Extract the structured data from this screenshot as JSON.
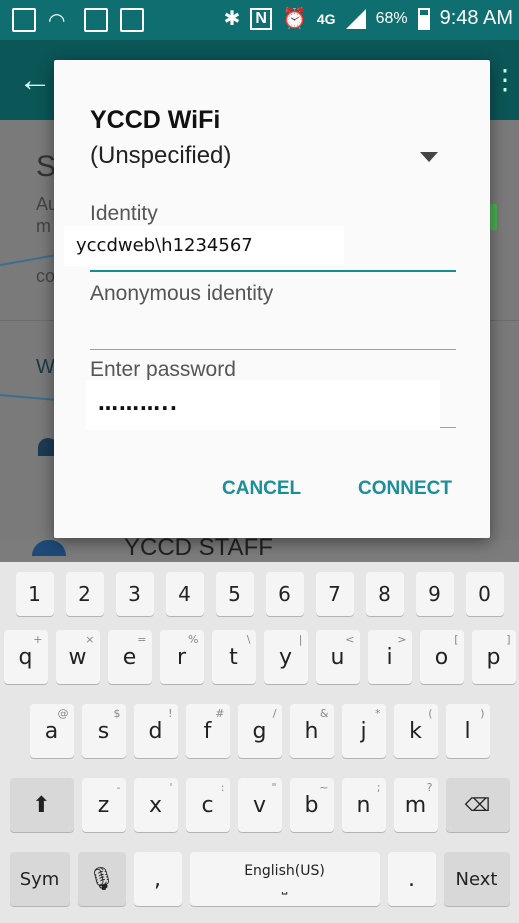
{
  "status_bar": {
    "battery_percent": "68%",
    "time": "9:48 AM",
    "network_type": "4G",
    "icons": [
      "gallery-icon",
      "wifi-calling-icon",
      "voicemail-icon",
      "email-icon",
      "bluetooth-icon",
      "nfc-icon",
      "alarm-icon",
      "signal-icon",
      "battery-icon"
    ]
  },
  "background": {
    "partial_title": "S",
    "partial_line1": "Au",
    "partial_line2": "m",
    "partial_line3": "co",
    "partial_section": "W",
    "network_below": "YCCD STAFF"
  },
  "dialog": {
    "title": "YCCD WiFi",
    "dropdown_value": "(Unspecified)",
    "identity_label": "Identity",
    "identity_value": "yccdweb\\h1234567",
    "anon_label": "Anonymous identity",
    "anon_value": "",
    "password_label": "Enter password",
    "password_value": "………..",
    "cancel_label": "CANCEL",
    "connect_label": "CONNECT"
  },
  "keyboard": {
    "number_row": [
      "1",
      "2",
      "3",
      "4",
      "5",
      "6",
      "7",
      "8",
      "9",
      "0"
    ],
    "row1": [
      {
        "k": "q",
        "s": "+"
      },
      {
        "k": "w",
        "s": "×"
      },
      {
        "k": "e",
        "s": "="
      },
      {
        "k": "r",
        "s": "%"
      },
      {
        "k": "t",
        "s": "\\"
      },
      {
        "k": "y",
        "s": "|"
      },
      {
        "k": "u",
        "s": "<"
      },
      {
        "k": "i",
        "s": ">"
      },
      {
        "k": "o",
        "s": "["
      },
      {
        "k": "p",
        "s": "]"
      }
    ],
    "row2": [
      {
        "k": "a",
        "s": "@"
      },
      {
        "k": "s",
        "s": "$"
      },
      {
        "k": "d",
        "s": "!"
      },
      {
        "k": "f",
        "s": "#"
      },
      {
        "k": "g",
        "s": "/"
      },
      {
        "k": "h",
        "s": "&"
      },
      {
        "k": "j",
        "s": "*"
      },
      {
        "k": "k",
        "s": "("
      },
      {
        "k": "l",
        "s": ")"
      }
    ],
    "row3": [
      {
        "k": "z",
        "s": "-"
      },
      {
        "k": "x",
        "s": "'"
      },
      {
        "k": "c",
        "s": ":"
      },
      {
        "k": "v",
        "s": "\""
      },
      {
        "k": "b",
        "s": "~"
      },
      {
        "k": "n",
        "s": ";"
      },
      {
        "k": "m",
        "s": "?"
      }
    ],
    "sym_label": "Sym",
    "comma_label": ",",
    "space_label": "English(US)",
    "period_label": ".",
    "next_label": "Next"
  }
}
